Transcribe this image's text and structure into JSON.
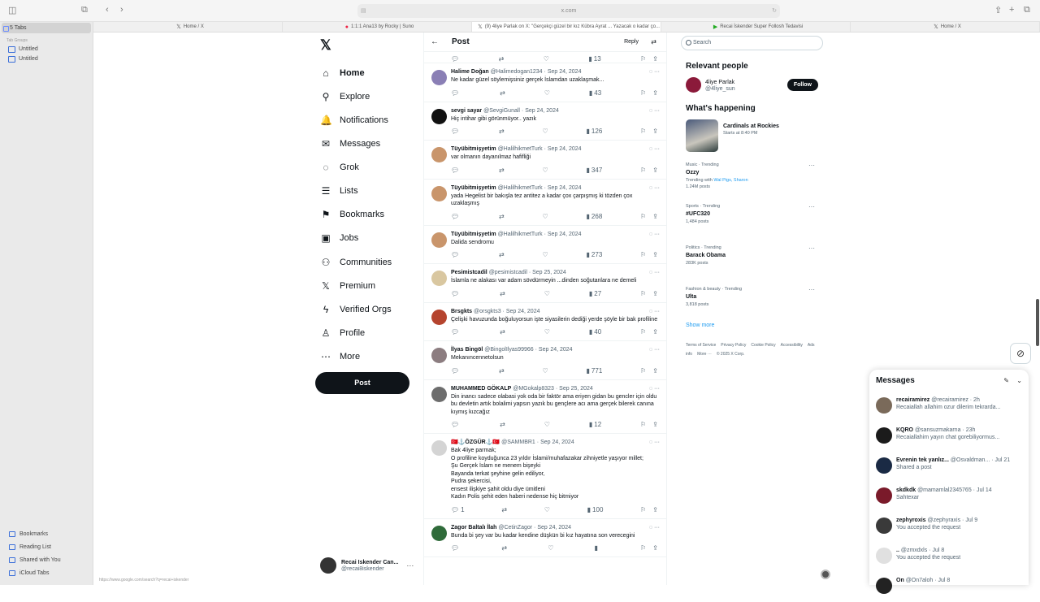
{
  "browser": {
    "url": "x.com",
    "tabs": [
      {
        "label": "Home / X",
        "icon": "x-icon",
        "active": false
      },
      {
        "label": "1:1:1 Ana13 by Rocky | Suno",
        "icon": "suno-icon",
        "active": false
      },
      {
        "label": "(9) 4liye Parlak on X: \"Gerçekçi güzel bir kız Kübra Ayrat ... Yazacak o kadar ço...",
        "icon": "x-icon",
        "active": true
      },
      {
        "label": "Recai İskender Super Follosh Tedavisi",
        "icon": "leaf-icon",
        "active": false
      },
      {
        "label": "Home / X",
        "icon": "x-icon",
        "active": false
      }
    ],
    "sidebar": {
      "tabs_label": "5 Tabs",
      "group_header": "Tab Groups",
      "groups": [
        "Untitled",
        "Untitled"
      ],
      "bottom": [
        "Bookmarks",
        "Reading List",
        "Shared with You",
        "iCloud Tabs"
      ]
    },
    "status_url": "https://www.google.com/search?q=recai+iskender"
  },
  "nav": {
    "logo": "𝕏",
    "items": [
      {
        "label": "Home",
        "icon": "home-icon",
        "glyph": "⌂"
      },
      {
        "label": "Explore",
        "icon": "search-icon",
        "glyph": "⚲"
      },
      {
        "label": "Notifications",
        "icon": "bell-icon",
        "glyph": "🔔"
      },
      {
        "label": "Messages",
        "icon": "mail-icon",
        "glyph": "✉"
      },
      {
        "label": "Grok",
        "icon": "grok-icon",
        "glyph": "◌"
      },
      {
        "label": "Lists",
        "icon": "list-icon",
        "glyph": "☰"
      },
      {
        "label": "Bookmarks",
        "icon": "bookmark-icon",
        "glyph": "⚑"
      },
      {
        "label": "Jobs",
        "icon": "briefcase-icon",
        "glyph": "▣"
      },
      {
        "label": "Communities",
        "icon": "people-icon",
        "glyph": "⚇"
      },
      {
        "label": "Premium",
        "icon": "x-icon",
        "glyph": "𝕏"
      },
      {
        "label": "Verified Orgs",
        "icon": "bolt-icon",
        "glyph": "ϟ"
      },
      {
        "label": "Profile",
        "icon": "person-icon",
        "glyph": "♙"
      },
      {
        "label": "More",
        "icon": "more-icon",
        "glyph": "⋯"
      }
    ],
    "post_button": "Post",
    "account": {
      "name": "Recai Iskender Can...",
      "handle": "@recai8iskender"
    }
  },
  "feed": {
    "title": "Post",
    "reply_label": "Reply",
    "first_views": "13",
    "tweets": [
      {
        "name": "Halime Doğan",
        "handle": "@Halimedogan1234",
        "date": "Sep 24, 2024",
        "text": "Ne kadar güzel söylemişsiniz gerçek İslamdan uzaklaşmak...",
        "replies": "",
        "views": "43",
        "avatar": "#8a7fb5"
      },
      {
        "name": "sevgi sayar",
        "handle": "@SevgiGunall",
        "date": "Sep 24, 2024",
        "text": "Hiç intihar gibi görünmüyor.. yazık",
        "replies": "",
        "views": "126",
        "avatar": "#111111"
      },
      {
        "name": "Tüyübitmişyetim",
        "handle": "@HalilhikmetTurk",
        "date": "Sep 24, 2024",
        "text": "var olmanın dayanılmaz hafifliği",
        "replies": "",
        "views": "347",
        "avatar": "#c9956b"
      },
      {
        "name": "Tüyübitmişyetim",
        "handle": "@HalilhikmetTurk",
        "date": "Sep 24, 2024",
        "text": "yada Hegelist bir bakışla tez antitez a kadar çox çarpışmış ki tözden çox uzaklaşmış",
        "replies": "",
        "views": "268",
        "avatar": "#c9956b"
      },
      {
        "name": "Tüyübitmişyetim",
        "handle": "@HalilhikmetTurk",
        "date": "Sep 24, 2024",
        "text": "Dalida sendromu",
        "replies": "",
        "views": "273",
        "avatar": "#c9956b"
      },
      {
        "name": "Pesimistcadil",
        "handle": "@pesimistcadil",
        "date": "Sep 25, 2024",
        "text": "İslamla ne alakası var adam sövdürmeyin ...dinden soğutanlara ne demeli",
        "replies": "",
        "views": "27",
        "avatar": "#d9c7a0"
      },
      {
        "name": "Brsgkts",
        "handle": "@orsgkts3",
        "date": "Sep 24, 2024",
        "text": "Çelişki havuzunda boğuluyorsun işte siyasilerin dediği yerde şöyle bir bak profiline",
        "replies": "",
        "views": "40",
        "avatar": "#b5442e"
      },
      {
        "name": "İlyas Bingöl",
        "handle": "@BingolIlyas99966",
        "date": "Sep 24, 2024",
        "text": "Mekanıncennetolsun",
        "replies": "",
        "views": "771",
        "avatar": "#8c7d80"
      },
      {
        "name": "MUHAMMED GÖKALP",
        "handle": "@MGokalp8323",
        "date": "Sep 25, 2024",
        "text": "Din inancı sadece olabasi yok oda bir faktör ama eriyen gidan bu gencler için oldu bu devletin artık bolalimi yapsın yazık bu gençlere acı ama gerçek bilerek canına kıymış kızcağız",
        "replies": "",
        "views": "12",
        "avatar": "#6d6d6d"
      },
      {
        "name": "🇹🇷⚓ÖZGÜR⚓🇹🇷",
        "handle": "@SAMMBR1",
        "date": "Sep 24, 2024",
        "text": "Bak 4liye parmak;\nO profiline koyduğunca 23 yıldır İslami/muhafazakar zihniyetle yaşıyor millet;\nŞu Gerçek İslam ne menem bişeyki\nBayanda terkat şeyhine gelin ediliyor,\nPudra şekercisi,\nensest ilişkiye şahit oldu diye ümitleni\nKadın Polis şehit eden haberi nedense hiç bitmiyor",
        "replies": "1",
        "views": "100",
        "avatar": "#d4d4d4"
      },
      {
        "name": "Zagor Baltalı İlah",
        "handle": "@CetinZagor",
        "date": "Sep 24, 2024",
        "text": "Bunda bi şey var bu kadar kendine düşkün bi kız hayatına son verecegini",
        "replies": "",
        "views": "",
        "avatar": "#2f6b3a"
      }
    ]
  },
  "right": {
    "search_placeholder": "Search",
    "relevant_title": "Relevant people",
    "person": {
      "name": "4liye Parlak",
      "handle": "@4liye_sun",
      "follow": "Follow"
    },
    "happening_title": "What's happening",
    "event": {
      "title": "Cardinals at Rockies",
      "sub": "Starts at 8:40 PM"
    },
    "trends": [
      {
        "cat": "Music · Trending",
        "name": "Ozzy",
        "extra_prefix": "Trending with ",
        "extra_links": "Wal Pigs, Sharon",
        "count": "1.24M posts"
      },
      {
        "cat": "Sports · Trending",
        "name": "#UFC320",
        "extra_prefix": "",
        "extra_links": "",
        "count": "1,484 posts"
      },
      {
        "cat": "Politics · Trending",
        "name": "Barack Obama",
        "extra_prefix": "",
        "extra_links": "",
        "count": "283K posts"
      },
      {
        "cat": "Fashion & beauty · Trending",
        "name": "Ulta",
        "extra_prefix": "",
        "extra_links": "",
        "count": "3,818 posts"
      }
    ],
    "show_more": "Show more",
    "footer": [
      "Terms of Service",
      "Privacy Policy",
      "Cookie Policy",
      "Accessibility",
      "Ads info",
      "More ···",
      "© 2025 X Corp."
    ]
  },
  "messages": {
    "title": "Messages",
    "conversations": [
      {
        "name": "recairamirez",
        "handle": "@recairamirez · 2h",
        "preview": "Recaiallah allahim ozur dilerim tekrarda...",
        "avatar": "#7a6a5a"
      },
      {
        "name": "KQRO",
        "handle": "@sansuzmakarna · 23h",
        "preview": "Recaiallahim yayın chat gorebiliyormus...",
        "avatar": "#1b1b1b"
      },
      {
        "name": "Evrenin tek yanlız...",
        "handle": "@Osvaldman... · Jul 21",
        "preview": "Shared a post",
        "avatar": "#1a2a44"
      },
      {
        "name": "skdkdk",
        "handle": "@mamamlal2345765 · Jul 14",
        "preview": "Sahtexar",
        "avatar": "#7a1a2a"
      },
      {
        "name": "zephyroxis",
        "handle": "@zephyraxis · Jul 9",
        "preview": "You accepted the request",
        "avatar": "#3a3a3a"
      },
      {
        "name": "..",
        "handle": "@zmxdxls · Jul 8",
        "preview": "You accepted the request",
        "avatar": "#e0e0e0"
      },
      {
        "name": "On",
        "handle": "@On7aloh · Jul 8",
        "preview": "",
        "avatar": "#222222"
      }
    ]
  }
}
